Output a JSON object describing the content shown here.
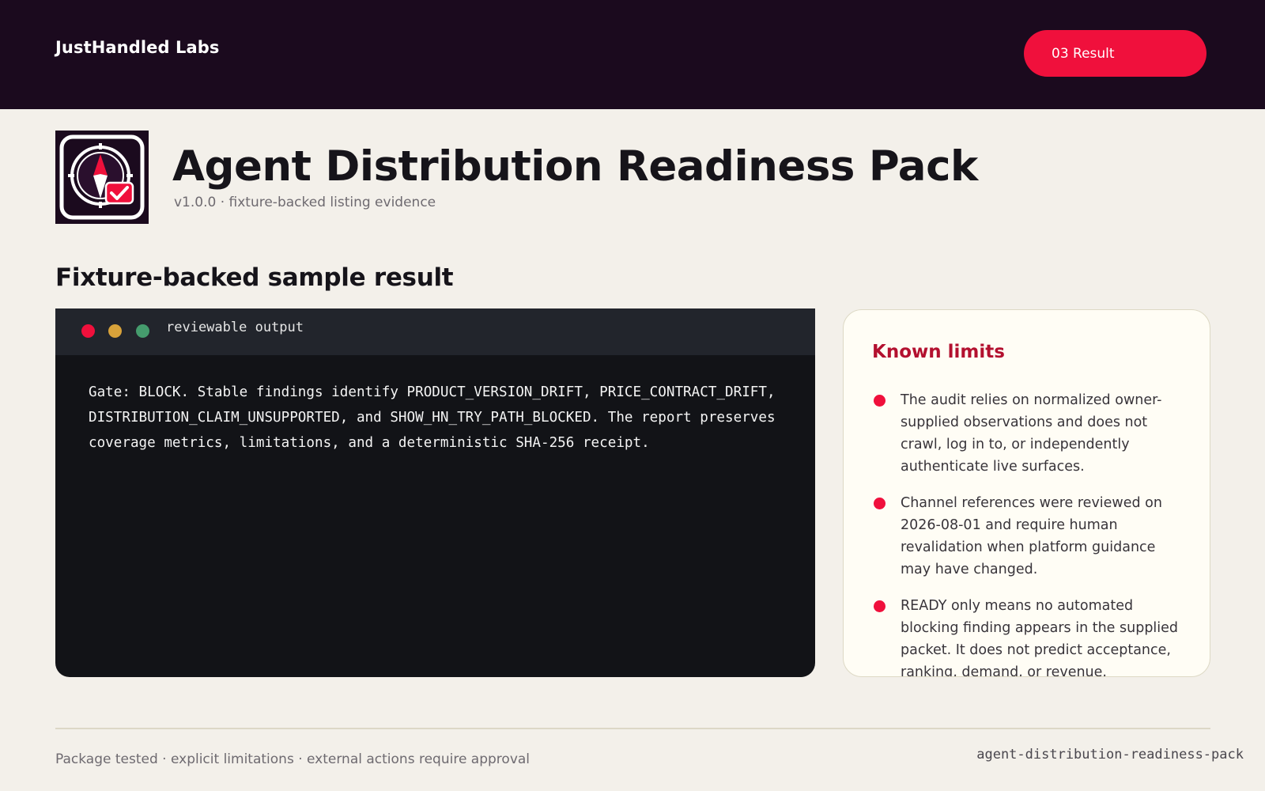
{
  "header": {
    "brand": "JustHandled Labs",
    "step_button": "03 Result"
  },
  "product": {
    "logo_icon": "compass-check-icon",
    "title": "Agent Distribution Readiness Pack",
    "subtitle": "v1.0.0 · fixture-backed listing evidence"
  },
  "section": {
    "heading": "Fixture-backed sample result"
  },
  "terminal": {
    "title": "reviewable output",
    "output": "Gate: BLOCK. Stable findings identify PRODUCT_VERSION_DRIFT, PRICE_CONTRACT_DRIFT, DISTRIBUTION_CLAIM_UNSUPPORTED, and SHOW_HN_TRY_PATH_BLOCKED. The report preserves coverage metrics, limitations, and a deterministic SHA-256 receipt.",
    "dot_colors": [
      "#f0103c",
      "#d8a23a",
      "#459c6d"
    ]
  },
  "limits": {
    "heading": "Known limits",
    "items": [
      "The audit relies on normalized owner-supplied observations and does not crawl, log in to, or independently authenticate live surfaces.",
      "Channel references were reviewed on 2026-08-01 and require human revalidation when platform guidance may have changed.",
      "READY only means no automated blocking finding appears in the supplied packet. It does not predict acceptance, ranking, demand, or revenue."
    ]
  },
  "footer": {
    "left": "Package tested · explicit limitations · external actions require approval",
    "right": "agent-distribution-readiness-pack"
  },
  "colors": {
    "header_bg": "#1b0a1e",
    "accent": "#f0103c",
    "limits_heading": "#b3102f",
    "page_bg": "#f3f0ea"
  }
}
